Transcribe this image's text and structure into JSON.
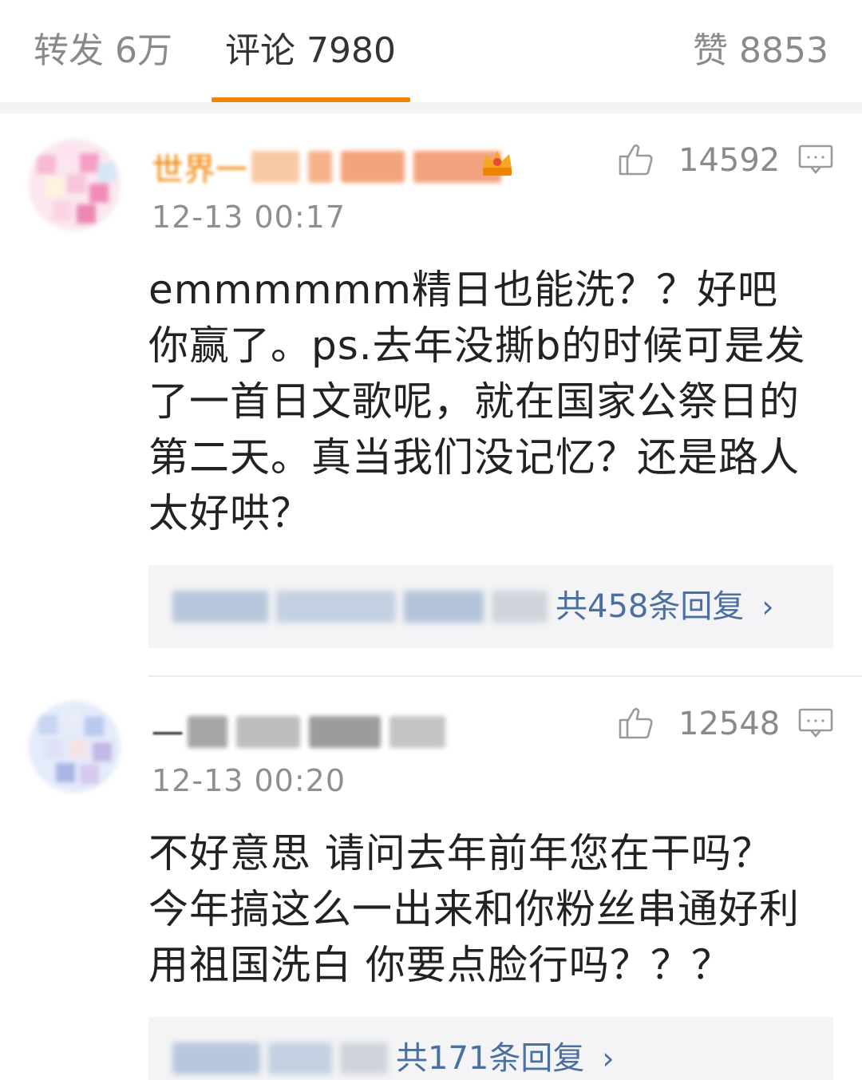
{
  "tabs": [
    {
      "label": "转发",
      "count": "6万"
    },
    {
      "label": "评论",
      "count": "7980"
    },
    {
      "label": "赞",
      "count": "8853"
    }
  ],
  "accent_color": "#f08300",
  "link_color": "#4a6fa0",
  "comments": [
    {
      "username_fragment": "世界一",
      "vip_icon": "crown-icon",
      "like_count": "14592",
      "timestamp": "12-13 00:17",
      "text": "emmmmmm精日也能洗？？好吧你赢了。ps.去年没撕b的时候可是发了一首日文歌呢，就在国家公祭日的第二天。真当我们没记忆？还是路人太好哄？",
      "replies_label": "共458条回复"
    },
    {
      "username_fragment": "一",
      "like_count": "12548",
      "timestamp": "12-13 00:20",
      "text": "不好意思 请问去年前年您在干吗？今年搞这么一出来和你粉丝串通好利用祖国洗白 你要点脸行吗？？？",
      "replies_label": "共171条回复"
    }
  ]
}
